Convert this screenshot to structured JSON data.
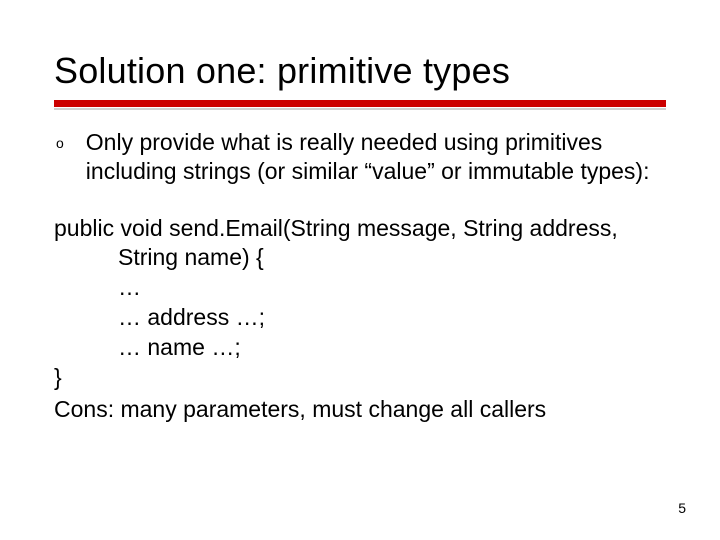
{
  "title": "Solution one: primitive types",
  "bullet": {
    "marker": "o",
    "text": "Only provide what is really needed using primitives including strings (or similar “value” or immutable types):"
  },
  "code": {
    "sig": "public void send.Email(String message, String address, String name) {",
    "l1": "…",
    "l2": "… address …;",
    "l3": "… name …;",
    "close": "}"
  },
  "cons": "Cons: many parameters, must change all callers",
  "page": "5"
}
